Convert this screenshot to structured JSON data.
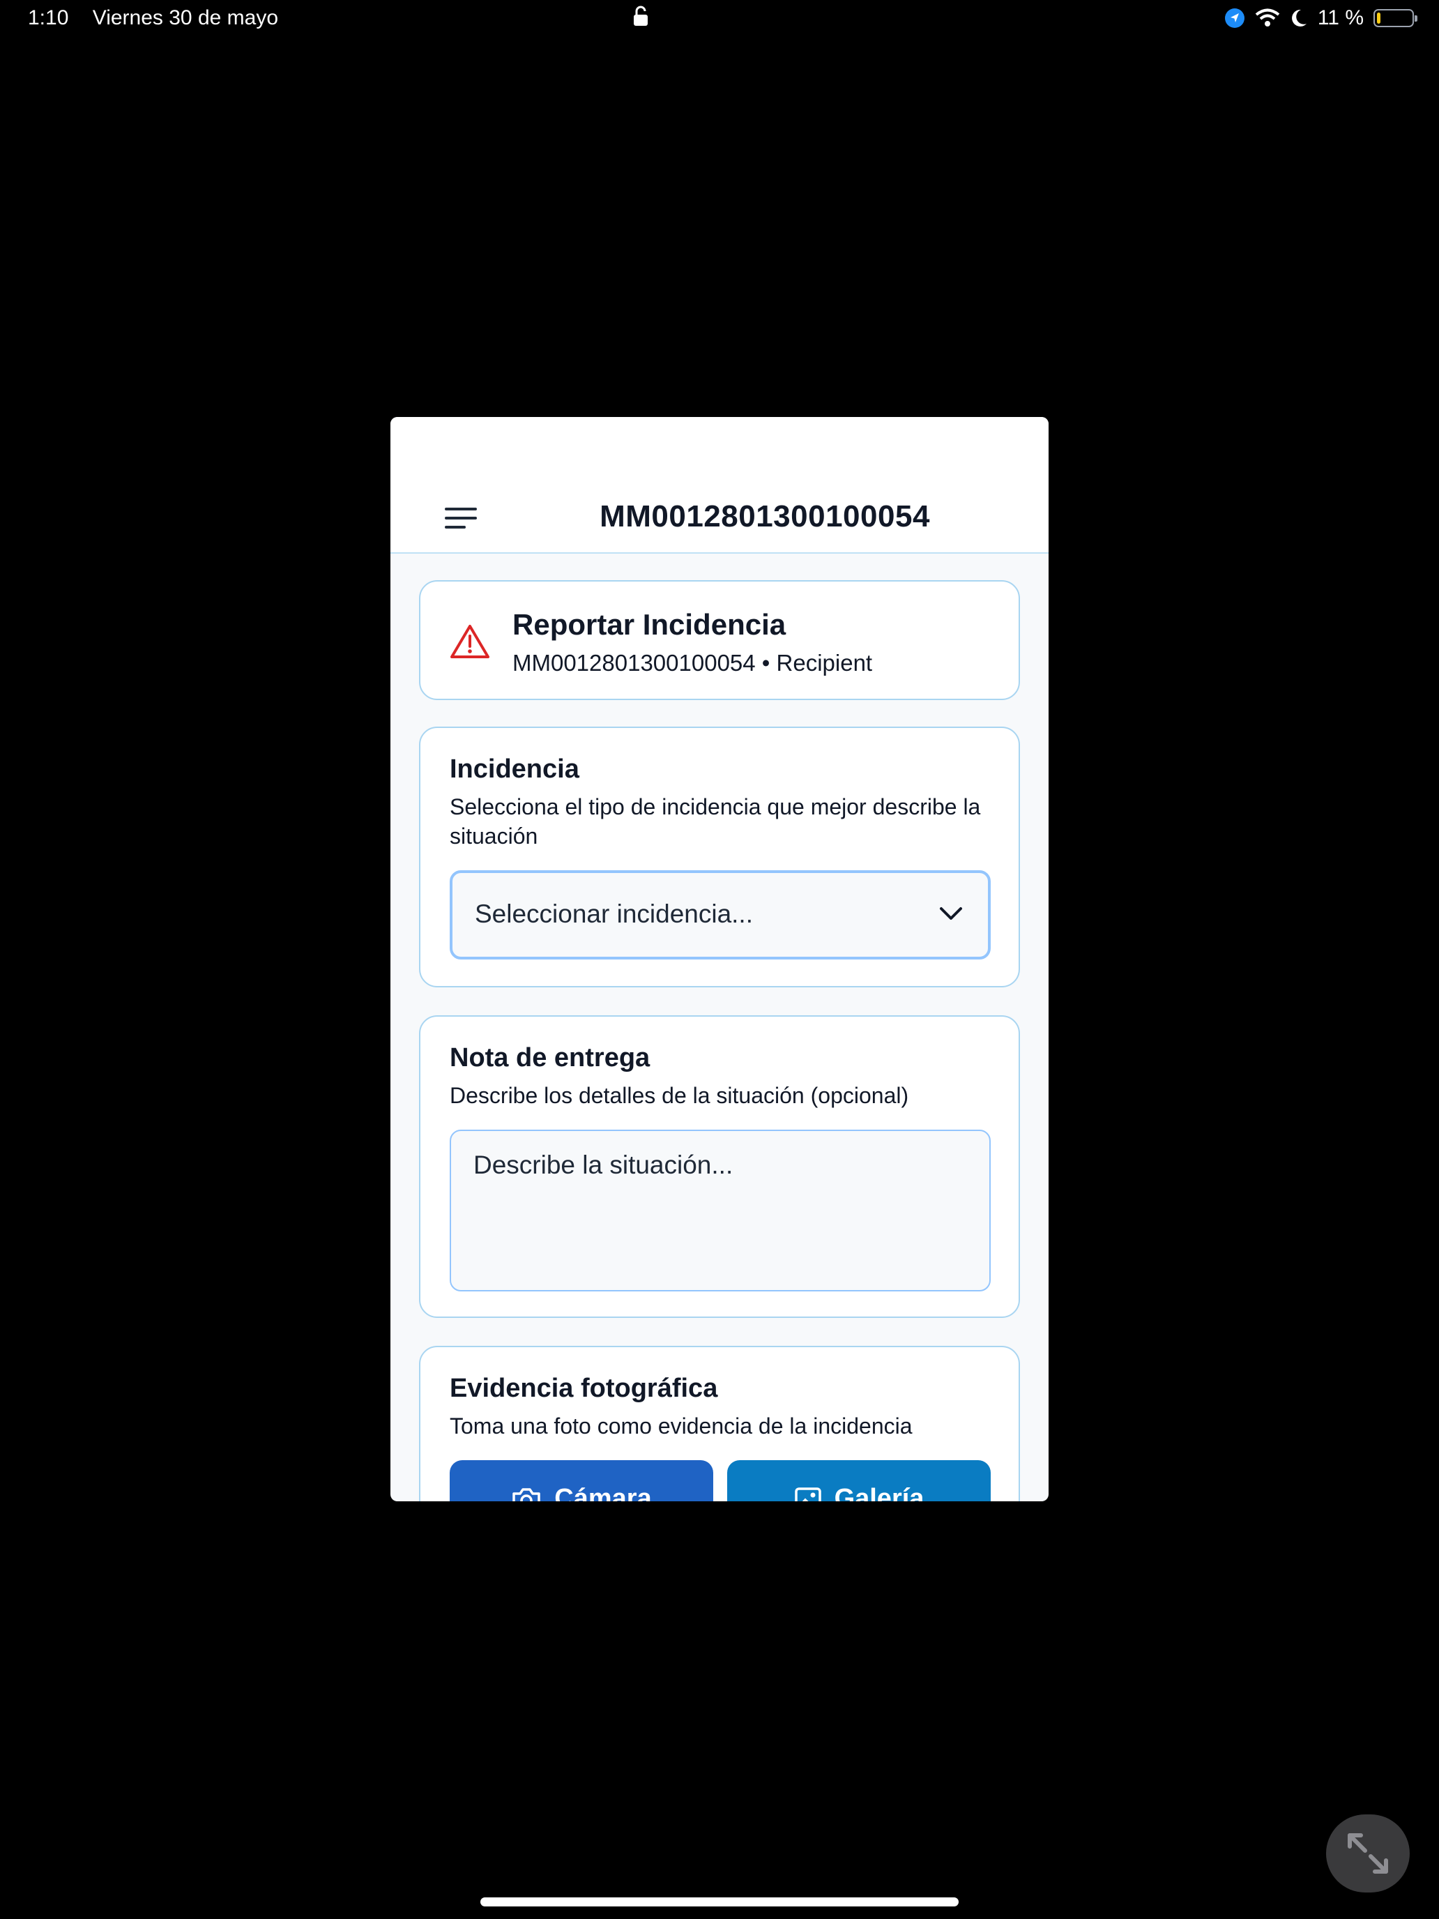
{
  "status_bar": {
    "time": "1:10",
    "date": "Viernes 30 de mayo",
    "battery_percent": "11 %",
    "battery_level": 0.11,
    "icons": [
      "location-icon",
      "wifi-icon",
      "moon-icon",
      "battery-icon"
    ],
    "lock_icon": "lock-icon"
  },
  "app": {
    "title": "MM0012801300100054",
    "menu_icon": "menu-icon"
  },
  "report_header": {
    "icon": "warning-icon",
    "title": "Reportar Incidencia",
    "subtitle": "MM0012801300100054 • Recipient"
  },
  "incidencia": {
    "title": "Incidencia",
    "description": "Selecciona el tipo de incidencia que mejor describe la situación",
    "select_placeholder": "Seleccionar incidencia..."
  },
  "nota": {
    "title": "Nota de entrega",
    "description": "Describe los detalles de la situación (opcional)",
    "placeholder": "Describe la situación..."
  },
  "evidencia": {
    "title": "Evidencia fotográfica",
    "description": "Toma una foto como evidencia de la incidencia",
    "camera_button": "Cámara",
    "gallery_button": "Galería"
  },
  "colors": {
    "primary_blue": "#1f63c4",
    "gallery_blue": "#0a7cc2",
    "card_border": "#a9d5f1",
    "warning_red": "#dc2626"
  }
}
